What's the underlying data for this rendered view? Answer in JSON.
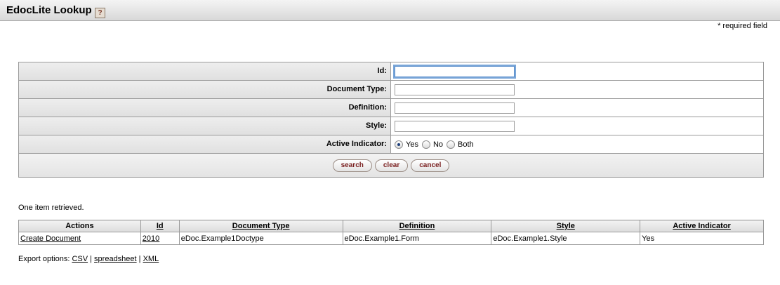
{
  "page": {
    "title": "EdocLite Lookup",
    "help_glyph": "?",
    "required_note": "* required field"
  },
  "criteria": {
    "fields": [
      {
        "label": "Id:",
        "value": ""
      },
      {
        "label": "Document Type:",
        "value": ""
      },
      {
        "label": "Definition:",
        "value": ""
      },
      {
        "label": "Style:",
        "value": ""
      }
    ],
    "active_indicator": {
      "label": "Active Indicator:",
      "options": [
        "Yes",
        "No",
        "Both"
      ],
      "selected": "Yes"
    },
    "buttons": {
      "search": "search",
      "clear": "clear",
      "cancel": "cancel"
    }
  },
  "results": {
    "count_text": "One item retrieved.",
    "columns": [
      "Actions",
      "Id",
      "Document Type",
      "Definition",
      "Style",
      "Active Indicator"
    ],
    "rows": [
      [
        "Create Document",
        "2010",
        "eDoc.Example1Doctype",
        "eDoc.Example1.Form",
        "eDoc.Example1.Style",
        "Yes"
      ]
    ]
  },
  "export": {
    "label": "Export options:",
    "options": [
      "CSV",
      "spreadsheet",
      "XML"
    ],
    "separator": "|"
  },
  "colors": {
    "button_text": "#7a1f1f",
    "focus_ring": "#7aa6d8"
  }
}
